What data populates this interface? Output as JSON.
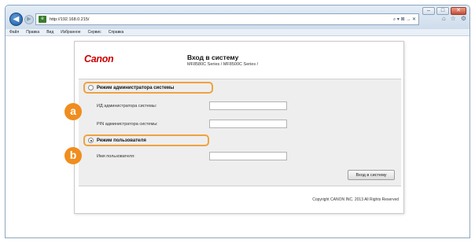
{
  "browser": {
    "url": "http://192.168.0.215/",
    "address_right": "⌕ ▾ ⊠ → ✕",
    "menu": [
      "Файл",
      "Правка",
      "Вид",
      "Избранное",
      "Сервис",
      "Справка"
    ],
    "toolbar_icons": [
      "home-icon",
      "favorites-icon",
      "tools-icon"
    ]
  },
  "page": {
    "logo": "Canon",
    "title": "Вход в систему",
    "subtitle": "MF8580C Series / MF8500C Series /",
    "admin_mode": {
      "label": "Режим администратора системы",
      "selected": false,
      "fields": [
        {
          "label": "ИД администратора системы:",
          "value": ""
        },
        {
          "label": "PIN администратора системы:",
          "value": ""
        }
      ]
    },
    "user_mode": {
      "label": "Режим пользователя",
      "selected": true,
      "fields": [
        {
          "label": "Имя пользователя:",
          "value": ""
        }
      ]
    },
    "login_button": "Вход в систему",
    "copyright": "Copyright CANON INC. 2013 All Rights Reserved"
  },
  "annotations": {
    "a": "a",
    "b": "b",
    "color": "#f08d1e"
  }
}
